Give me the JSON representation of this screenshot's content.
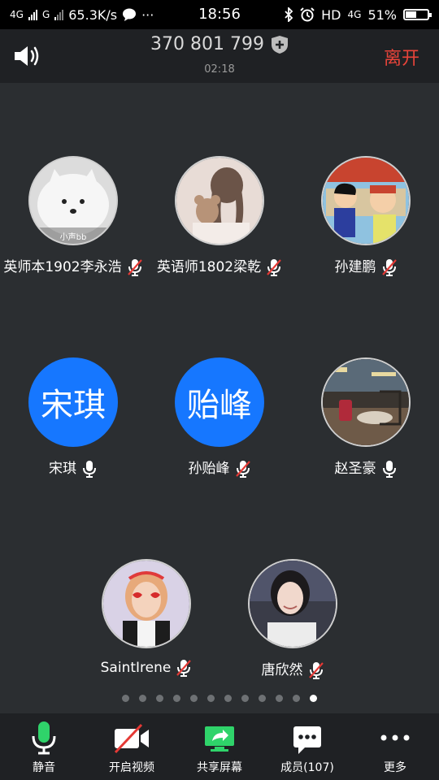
{
  "status_bar": {
    "network1": "4G",
    "network2": "G",
    "speed": "65.3K/s",
    "more": "···",
    "time": "18:56",
    "hd": "HD",
    "network3": "4G",
    "battery_percent": "51%",
    "battery_level": 0.51
  },
  "header": {
    "meeting_id": "370 801 799",
    "duration": "02:18",
    "leave_label": "离开"
  },
  "participants": [
    {
      "name": "英师本1902李永浩",
      "muted": true
    },
    {
      "name": "英语师1802梁乾",
      "muted": true
    },
    {
      "name": "孙建鹏",
      "muted": true
    },
    {
      "name": "宋琪",
      "initials": "宋琪",
      "muted": false
    },
    {
      "name": "孙贻峰",
      "initials": "贻峰",
      "muted": true
    },
    {
      "name": "赵圣豪",
      "muted": false
    },
    {
      "name": "SaintIrene",
      "muted": true
    },
    {
      "name": "唐欣然",
      "muted": true
    }
  ],
  "avatar1_caption": "小声bb",
  "pagination": {
    "total": 12,
    "active_index": 11
  },
  "toolbar": {
    "mute_label": "静音",
    "video_label": "开启视频",
    "share_label": "共享屏幕",
    "members_label": "成员(107)",
    "more_label": "更多"
  },
  "colors": {
    "accent_blue": "#1677ff",
    "leave_red": "#e8443a",
    "mic_green": "#2fd36a",
    "muted_red": "#e53935"
  }
}
